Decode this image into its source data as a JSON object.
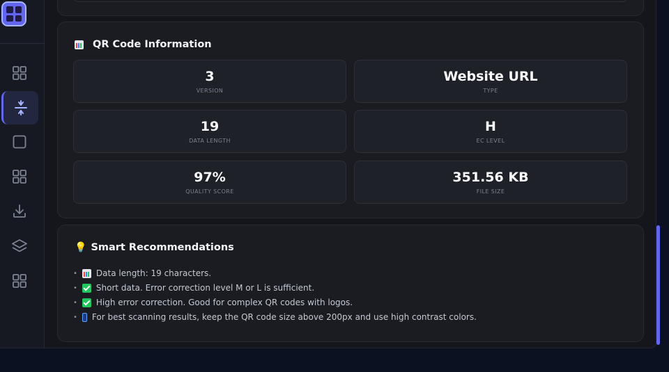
{
  "sidebar": {
    "logo_icon": "grid-logo-icon",
    "items": [
      {
        "name": "dashboard",
        "icon": "grid-icon"
      },
      {
        "name": "compress",
        "icon": "arrows-vertical-icon",
        "active": true
      },
      {
        "name": "square",
        "icon": "square-icon"
      },
      {
        "name": "apps",
        "icon": "grid-icon"
      },
      {
        "name": "download",
        "icon": "download-icon"
      },
      {
        "name": "layers",
        "icon": "layers-icon"
      },
      {
        "name": "more",
        "icon": "grid-icon"
      }
    ]
  },
  "info_card": {
    "title": "QR Code Information",
    "title_icon": "bar-chart-emoji",
    "stats": [
      {
        "value": "3",
        "label": "VERSION"
      },
      {
        "value": "Website URL",
        "label": "TYPE"
      },
      {
        "value": "19",
        "label": "DATA LENGTH"
      },
      {
        "value": "H",
        "label": "EC LEVEL"
      },
      {
        "value": "97%",
        "label": "QUALITY SCORE"
      },
      {
        "value": "351.56 KB",
        "label": "FILE SIZE"
      }
    ]
  },
  "recommendations": {
    "title": "Smart Recommendations",
    "title_icon": "lightbulb-emoji",
    "items": [
      {
        "icon": "bar-chart-emoji",
        "text": "Data length: 19 characters."
      },
      {
        "icon": "check-emoji",
        "text": "Short data. Error correction level M or L is sufficient."
      },
      {
        "icon": "check-emoji",
        "text": "High error correction. Good for complex QR codes with logos."
      },
      {
        "icon": "mobile-phone-emoji",
        "text": "For best scanning results, keep the QR code size above 200px and use high contrast colors."
      }
    ]
  },
  "colors": {
    "accent": "#6366f1",
    "background": "#0b1120",
    "card": "#1a1c22",
    "stat_box": "#1f2128"
  }
}
